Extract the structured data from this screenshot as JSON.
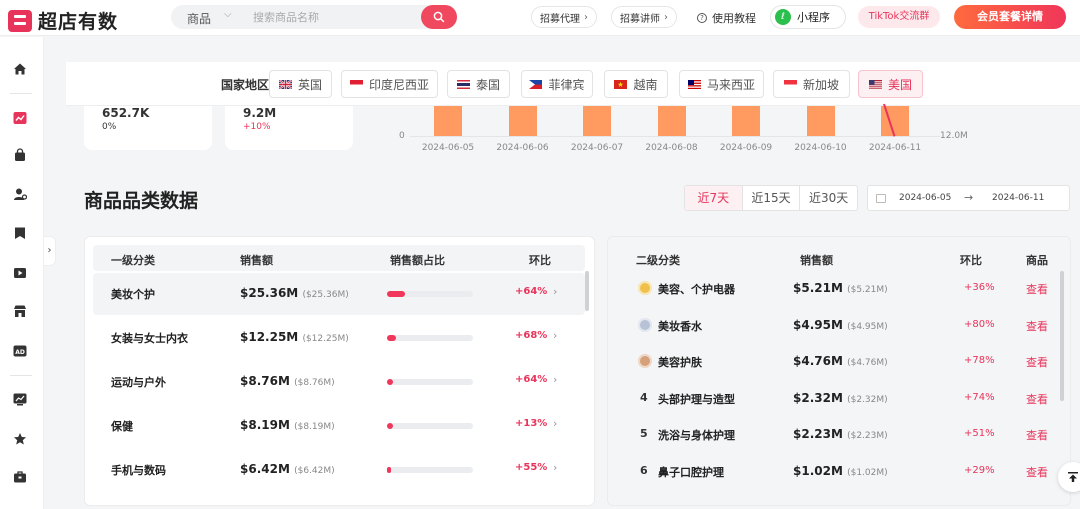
{
  "brand": {
    "name": "超店有数"
  },
  "search": {
    "type": "商品",
    "placeholder": "搜索商品名称"
  },
  "header": {
    "agent_label": "招募代理",
    "lecturer_label": "招募讲师",
    "tutorial_label": "使用教程",
    "mini_program_label": "小程序",
    "tiktok_group_label": "TikTok交流群",
    "member_label": "会员套餐详情"
  },
  "country_filter": {
    "label": "国家地区",
    "countries": [
      "英国",
      "印度尼西亚",
      "泰国",
      "菲律宾",
      "越南",
      "马来西亚",
      "新加坡",
      "美国"
    ],
    "selected": "美国"
  },
  "stats": [
    {
      "value": "652.7K",
      "change": "0%"
    },
    {
      "value": "9.2M",
      "change": "+10%"
    }
  ],
  "chart_data": {
    "type": "bar",
    "categories": [
      "2024-06-05",
      "2024-06-06",
      "2024-06-07",
      "2024-06-08",
      "2024-06-09",
      "2024-06-10",
      "2024-06-11"
    ],
    "y_left_label": "0",
    "y_right_label": "12.0M"
  },
  "section": {
    "title": "商品品类数据",
    "tabs": [
      "近7天",
      "近15天",
      "近30天"
    ],
    "active_tab": "近7天",
    "date_start": "2024-06-05",
    "date_sep": "→",
    "date_end": "2024-06-11"
  },
  "level1": {
    "headers": [
      "一级分类",
      "销售额",
      "销售额占比",
      "环比"
    ],
    "rows": [
      {
        "name": "美妆个护",
        "sales": "$25.36M",
        "sales_exact": "($25.36M)",
        "share": 0.21,
        "change": "+64%"
      },
      {
        "name": "女装与女士内衣",
        "sales": "$12.25M",
        "sales_exact": "($12.25M)",
        "share": 0.1,
        "change": "+68%"
      },
      {
        "name": "运动与户外",
        "sales": "$8.76M",
        "sales_exact": "($8.76M)",
        "share": 0.07,
        "change": "+64%"
      },
      {
        "name": "保健",
        "sales": "$8.19M",
        "sales_exact": "($8.19M)",
        "share": 0.065,
        "change": "+13%"
      },
      {
        "name": "手机与数码",
        "sales": "$6.42M",
        "sales_exact": "($6.42M)",
        "share": 0.05,
        "change": "+55%"
      }
    ]
  },
  "level2": {
    "headers": [
      "二级分类",
      "销售额",
      "环比",
      "商品"
    ],
    "link_label": "查看",
    "rows": [
      {
        "rank": "1",
        "name": "美容、个护电器",
        "sales": "$5.21M",
        "sales_exact": "($5.21M)",
        "change": "+36%"
      },
      {
        "rank": "2",
        "name": "美妆香水",
        "sales": "$4.95M",
        "sales_exact": "($4.95M)",
        "change": "+80%"
      },
      {
        "rank": "3",
        "name": "美容护肤",
        "sales": "$4.76M",
        "sales_exact": "($4.76M)",
        "change": "+78%"
      },
      {
        "rank": "4",
        "name": "头部护理与造型",
        "sales": "$2.32M",
        "sales_exact": "($2.32M)",
        "change": "+74%"
      },
      {
        "rank": "5",
        "name": "洗浴与身体护理",
        "sales": "$2.23M",
        "sales_exact": "($2.23M)",
        "change": "+51%"
      },
      {
        "rank": "6",
        "name": "鼻子口腔护理",
        "sales": "$1.02M",
        "sales_exact": "($1.02M)",
        "change": "+29%"
      }
    ]
  },
  "icons": {
    "sidebar": [
      "home-icon",
      "trend-icon",
      "bag-icon",
      "user-icon",
      "bookmark-icon",
      "video-icon",
      "store-icon",
      "ad-icon",
      "analytics-icon",
      "star-icon",
      "toolbox-icon"
    ]
  },
  "colors": {
    "accent": "#e8345a",
    "bar": "#ff9a60"
  }
}
